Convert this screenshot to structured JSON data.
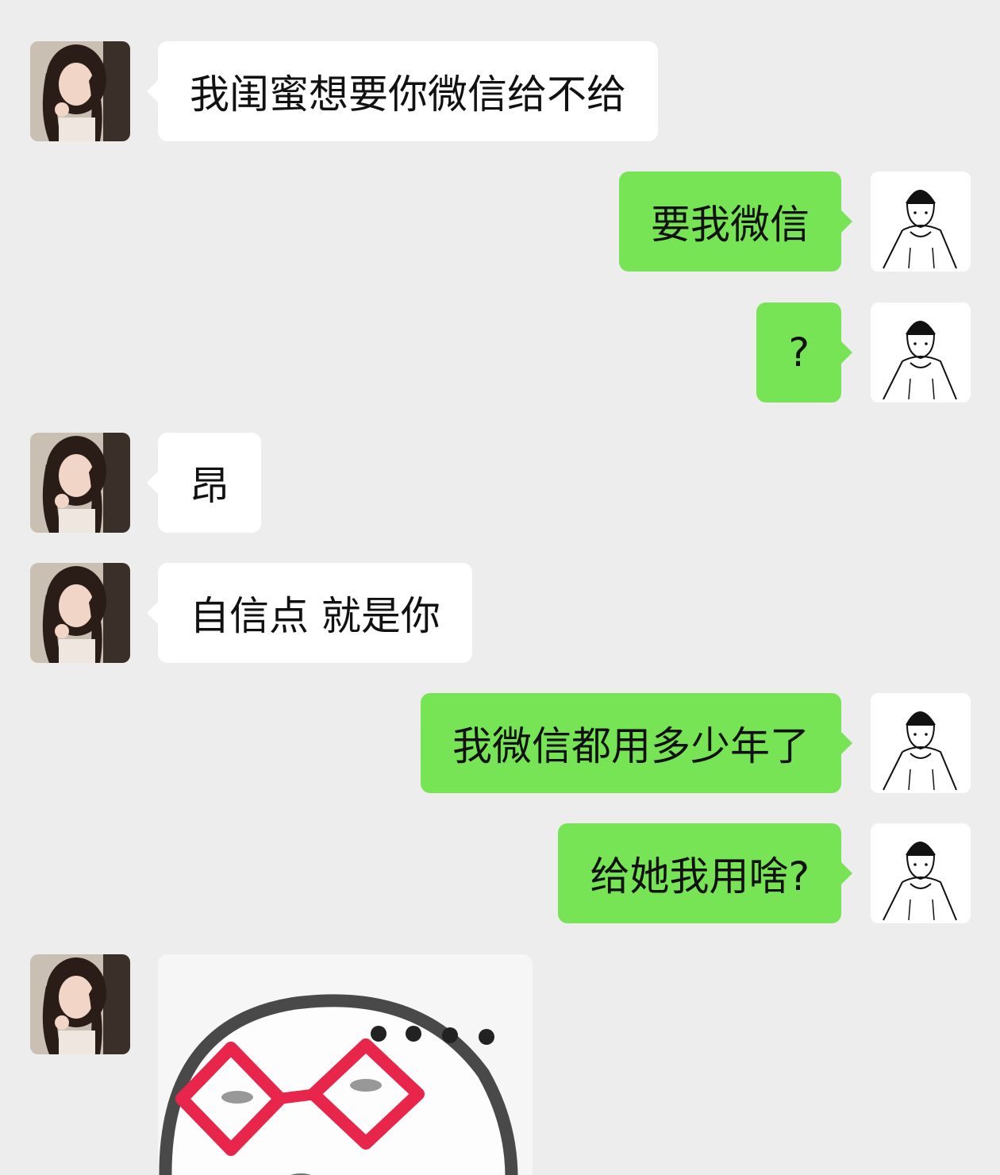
{
  "conversation": {
    "messages": [
      {
        "side": "in",
        "text": "我闺蜜想要你微信给不给"
      },
      {
        "side": "out",
        "text": "要我微信"
      },
      {
        "side": "out",
        "text": "?"
      },
      {
        "side": "in",
        "text": "昂"
      },
      {
        "side": "in",
        "text": "自信点 就是你"
      },
      {
        "side": "out",
        "text": "我微信都用多少年了"
      },
      {
        "side": "out",
        "text": "给她我用啥?"
      },
      {
        "side": "in",
        "type": "sticker",
        "icon": "glasses-face-sticker"
      }
    ]
  },
  "colors": {
    "background": "#ededed",
    "incoming_bubble": "#ffffff",
    "outgoing_bubble": "#77e456",
    "glasses": "#e8254a"
  },
  "icons": {
    "left_avatar": "girl-photo-avatar",
    "right_avatar": "boy-sketch-avatar"
  }
}
